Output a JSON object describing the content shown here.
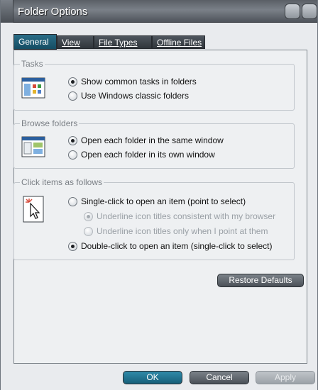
{
  "window": {
    "title": "Folder Options"
  },
  "tabs": [
    {
      "label": "General",
      "active": true
    },
    {
      "label": "View",
      "active": false
    },
    {
      "label": "File Types",
      "active": false
    },
    {
      "label": "Offline Files",
      "active": false
    }
  ],
  "tasks": {
    "legend": "Tasks",
    "options": [
      {
        "label": "Show common tasks in folders",
        "checked": true
      },
      {
        "label": "Use Windows classic folders",
        "checked": false
      }
    ]
  },
  "browse": {
    "legend": "Browse folders",
    "options": [
      {
        "label": "Open each folder in the same window",
        "checked": true
      },
      {
        "label": "Open each folder in its own window",
        "checked": false
      }
    ]
  },
  "click": {
    "legend": "Click items as follows",
    "options": [
      {
        "label": "Single-click to open an item (point to select)",
        "checked": false
      },
      {
        "label": "Underline icon titles consistent with my browser",
        "checked": true,
        "disabled": true
      },
      {
        "label": "Underline icon titles only when I point at them",
        "checked": false,
        "disabled": true
      },
      {
        "label": "Double-click to open an item (single-click to select)",
        "checked": true
      }
    ]
  },
  "buttons": {
    "restore": "Restore Defaults",
    "ok": "OK",
    "cancel": "Cancel",
    "apply": "Apply"
  },
  "icons": {
    "tasks": "folder-tasks-icon",
    "browse": "folder-window-icon",
    "click": "cursor-click-icon"
  },
  "colors": {
    "title_bar": "#5a5f66",
    "active_tab": "#1f607a",
    "ok_button": "#1f6f8c"
  }
}
